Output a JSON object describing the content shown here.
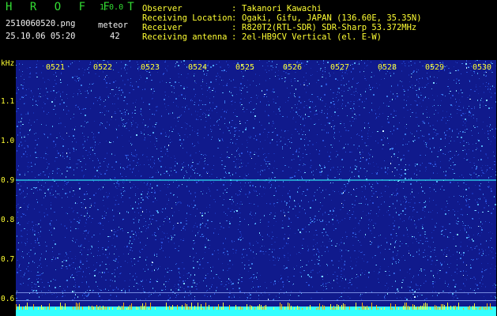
{
  "app": {
    "title": "H R O F F T",
    "version": "1.0.0"
  },
  "file": {
    "name": "2510060520.png",
    "timestamp": "25.10.06 05:20"
  },
  "meteor": {
    "label": "meteor",
    "count": "42"
  },
  "info": [
    {
      "label": "Observer",
      "value": "Takanori Kawachi"
    },
    {
      "label": "Receiving Location",
      "value": "Ogaki, Gifu, JAPAN (136.60E, 35.35N)"
    },
    {
      "label": "Receiver",
      "value": "R820T2(RTL-SDR) SDR-Sharp 53.372MHz"
    },
    {
      "label": "Receiving antenna",
      "value": "2el-HB9CV Vertical (el. E-W)"
    }
  ],
  "separator": ":",
  "axis": {
    "unit": "kHz",
    "y_ticks": [
      "1.1",
      "1.0",
      "0.9",
      "0.8",
      "0.7",
      "0.6"
    ],
    "x_ticks": [
      "0521",
      "0522",
      "0523",
      "0524",
      "0525",
      "0526",
      "0527",
      "0528",
      "0529",
      "0530"
    ]
  },
  "colors": {
    "background": "#000000",
    "label_yellow": "#ffff33",
    "title_green": "#33dd33",
    "spectrum_base": "#101a8c",
    "carrier_cyan": "#33ffff"
  }
}
